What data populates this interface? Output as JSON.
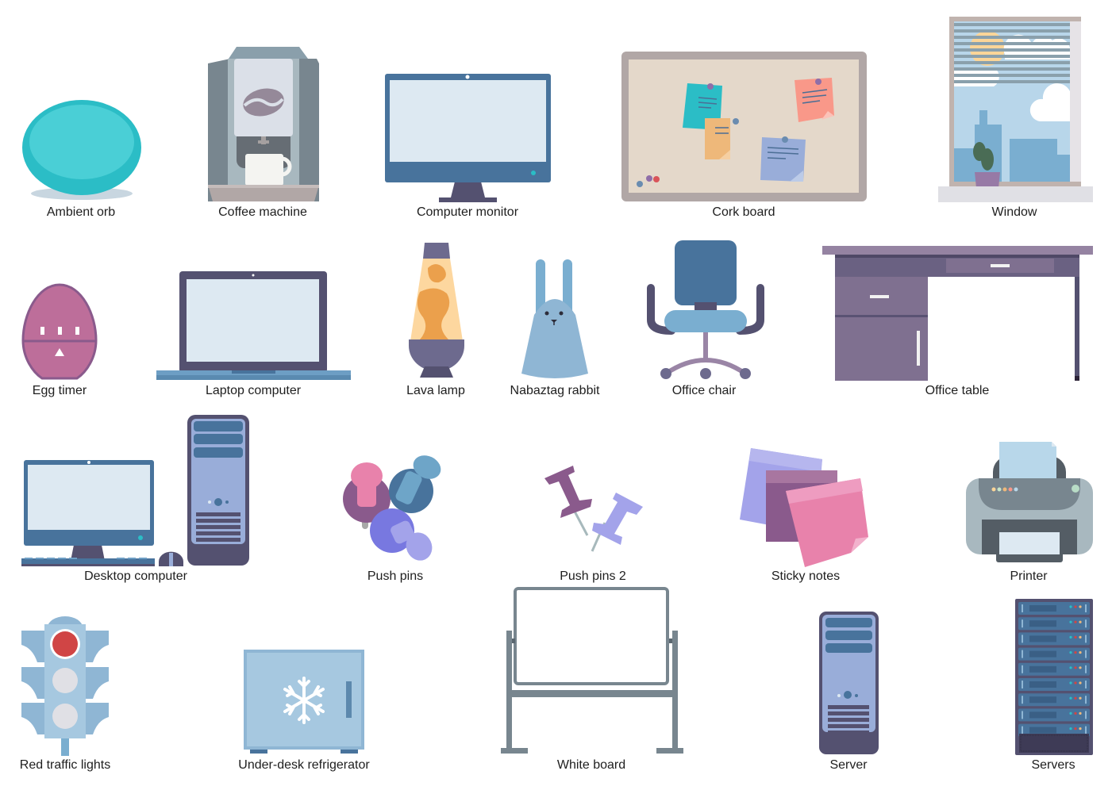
{
  "palette": {
    "label_text": "#1e1e1e",
    "teal": "#2bbdc6",
    "steel_blue": "#48739c",
    "dark_slate": "#545170",
    "purple": "#8a5a8c",
    "light_screen": "#dde9f2"
  },
  "items": [
    {
      "name": "ambient-orb",
      "label": "Ambient orb",
      "icon": "ambient-orb-icon"
    },
    {
      "name": "coffee-machine",
      "label": "Coffee machine",
      "icon": "coffee-machine-icon"
    },
    {
      "name": "computer-monitor",
      "label": "Computer monitor",
      "icon": "computer-monitor-icon"
    },
    {
      "name": "cork-board",
      "label": "Cork board",
      "icon": "cork-board-icon"
    },
    {
      "name": "window",
      "label": "Window",
      "icon": "window-icon"
    },
    {
      "name": "egg-timer",
      "label": "Egg timer",
      "icon": "egg-timer-icon"
    },
    {
      "name": "laptop-computer",
      "label": "Laptop computer",
      "icon": "laptop-icon"
    },
    {
      "name": "lava-lamp",
      "label": "Lava lamp",
      "icon": "lava-lamp-icon"
    },
    {
      "name": "nabaztag-rabbit",
      "label": "Nabaztag rabbit",
      "icon": "rabbit-icon"
    },
    {
      "name": "office-chair",
      "label": "Office chair",
      "icon": "office-chair-icon"
    },
    {
      "name": "office-table",
      "label": "Office table",
      "icon": "office-table-icon"
    },
    {
      "name": "desktop-computer",
      "label": "Desktop computer",
      "icon": "desktop-computer-icon"
    },
    {
      "name": "push-pins",
      "label": "Push pins",
      "icon": "push-pins-icon"
    },
    {
      "name": "push-pins-2",
      "label": "Push pins 2",
      "icon": "push-pins-2-icon"
    },
    {
      "name": "sticky-notes",
      "label": "Sticky notes",
      "icon": "sticky-notes-icon"
    },
    {
      "name": "printer",
      "label": "Printer",
      "icon": "printer-icon"
    },
    {
      "name": "red-traffic-lights",
      "label": "Red traffic lights",
      "icon": "traffic-light-icon"
    },
    {
      "name": "under-desk-refrigerator",
      "label": "Under-desk refrigerator",
      "icon": "refrigerator-icon"
    },
    {
      "name": "white-board",
      "label": "White board",
      "icon": "whiteboard-icon"
    },
    {
      "name": "server",
      "label": "Server",
      "icon": "server-icon"
    },
    {
      "name": "servers",
      "label": "Servers",
      "icon": "server-rack-icon"
    }
  ]
}
